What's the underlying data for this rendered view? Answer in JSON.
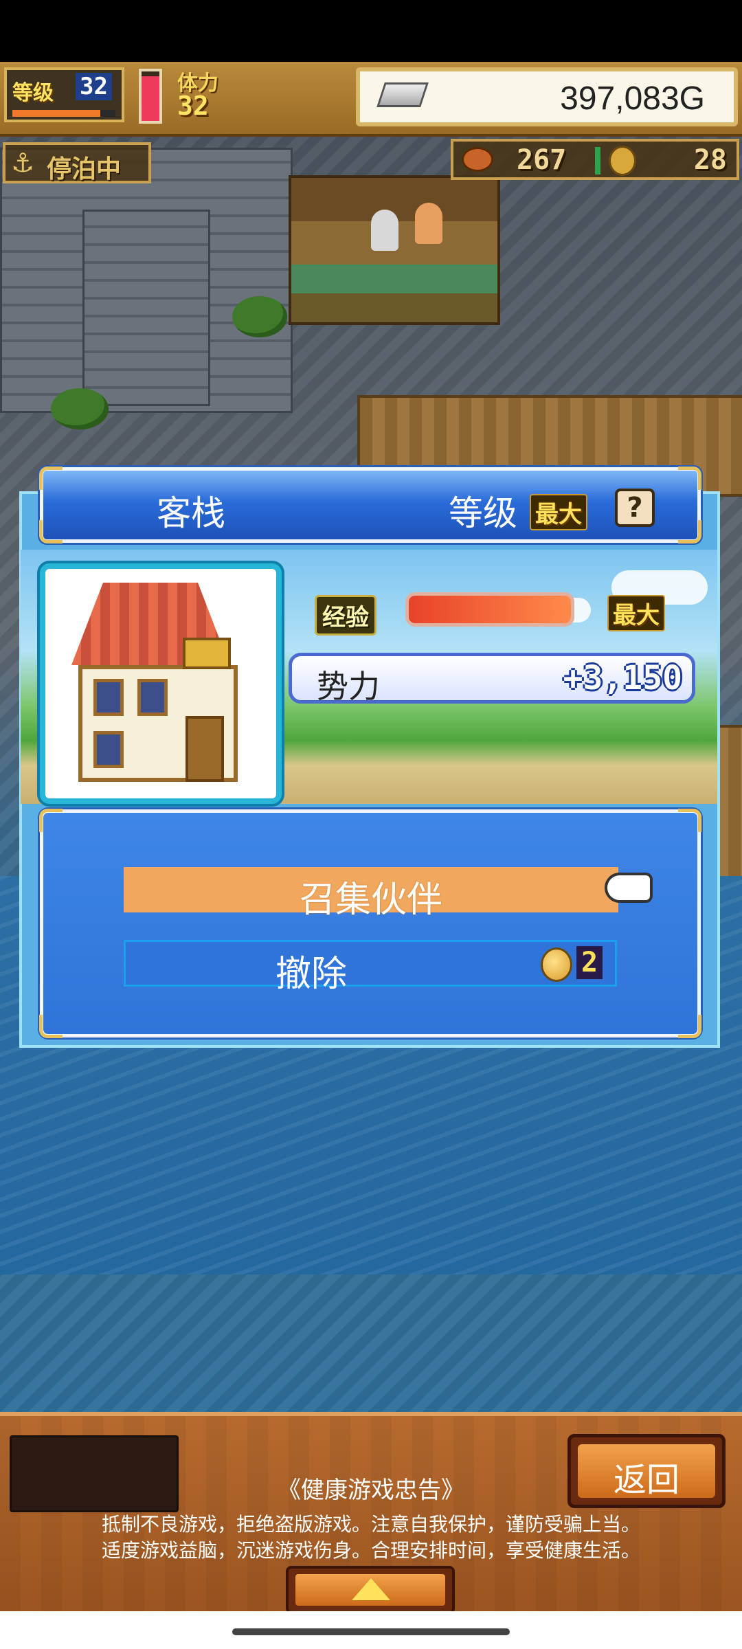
{
  "hud": {
    "level_label": "等级",
    "level_value": "32",
    "level_progress": 0.85,
    "stamina_label": "体力",
    "stamina_value": "32",
    "stamina_fill": 0.9,
    "gold_value": "397,083G",
    "mooring_icon": "anchor-icon",
    "mooring_label": "停泊中",
    "food_value": "267",
    "coin_value": "28"
  },
  "building": {
    "name": "客栈",
    "level_label": "等级",
    "level_max": "最大",
    "help": "?",
    "exp_label": "经验",
    "exp_fill": 1.0,
    "exp_max": "最大",
    "power_label": "势力",
    "power_value": "+3,150"
  },
  "actions": {
    "recruit_label": "召集伙伴",
    "remove_label": "撤除",
    "remove_cost": "2"
  },
  "bottom": {
    "back_label": "返回",
    "advice_title": "《健康游戏忠告》",
    "advice_line1": "抵制不良游戏，拒绝盗版游戏。注意自我保护，谨防受骗上当。",
    "advice_line2": "适度游戏益脑，沉迷游戏伤身。合理安排时间，享受健康生活。"
  },
  "colors": {
    "panel_blue": "#2f74d8",
    "recruit_orange": "#f0a85e",
    "gold_trim": "#e8c15a"
  }
}
